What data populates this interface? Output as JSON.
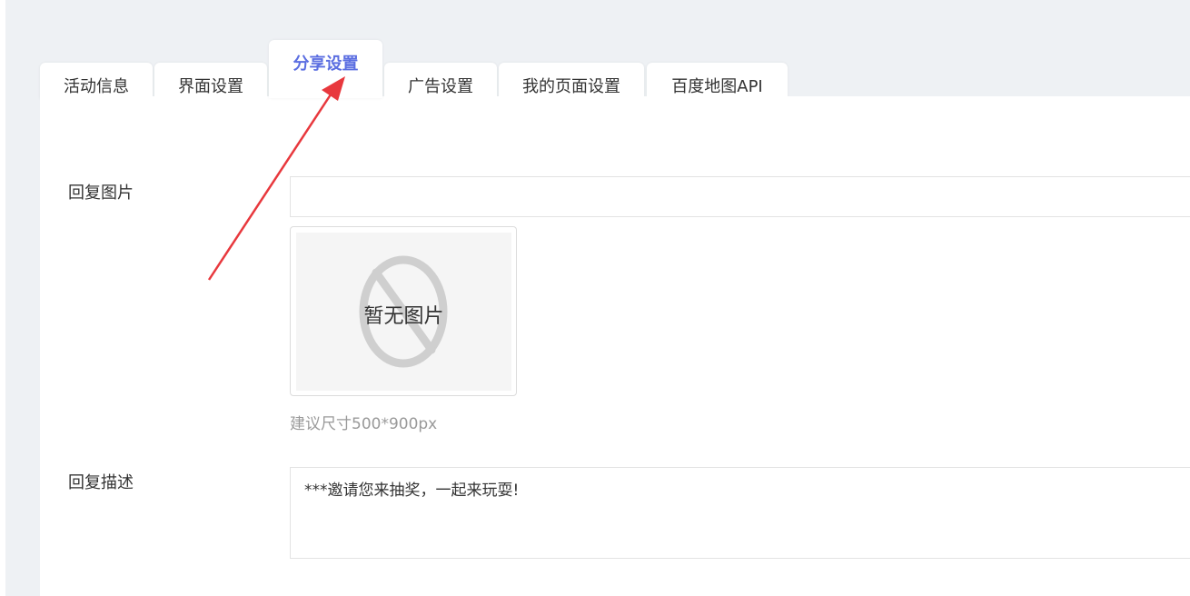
{
  "tabs": [
    {
      "label": "活动信息",
      "active": false
    },
    {
      "label": "界面设置",
      "active": false
    },
    {
      "label": "分享设置",
      "active": true
    },
    {
      "label": "广告设置",
      "active": false
    },
    {
      "label": "我的页面设置",
      "active": false
    },
    {
      "label": "百度地图API",
      "active": false
    }
  ],
  "form": {
    "reply_image_label": "回复图片",
    "reply_image_value": "",
    "no_image_text": "暂无图片",
    "size_hint": "建议尺寸500*900px",
    "reply_desc_label": "回复描述",
    "reply_desc_value": "***邀请您来抽奖，一起来玩耍!"
  },
  "colors": {
    "active_tab": "#5b6ee1",
    "annotation_arrow": "#e8383d",
    "page_bg": "#eef1f4"
  },
  "icons": {
    "placeholder": "no-image-icon",
    "annotation": "red-arrow"
  }
}
